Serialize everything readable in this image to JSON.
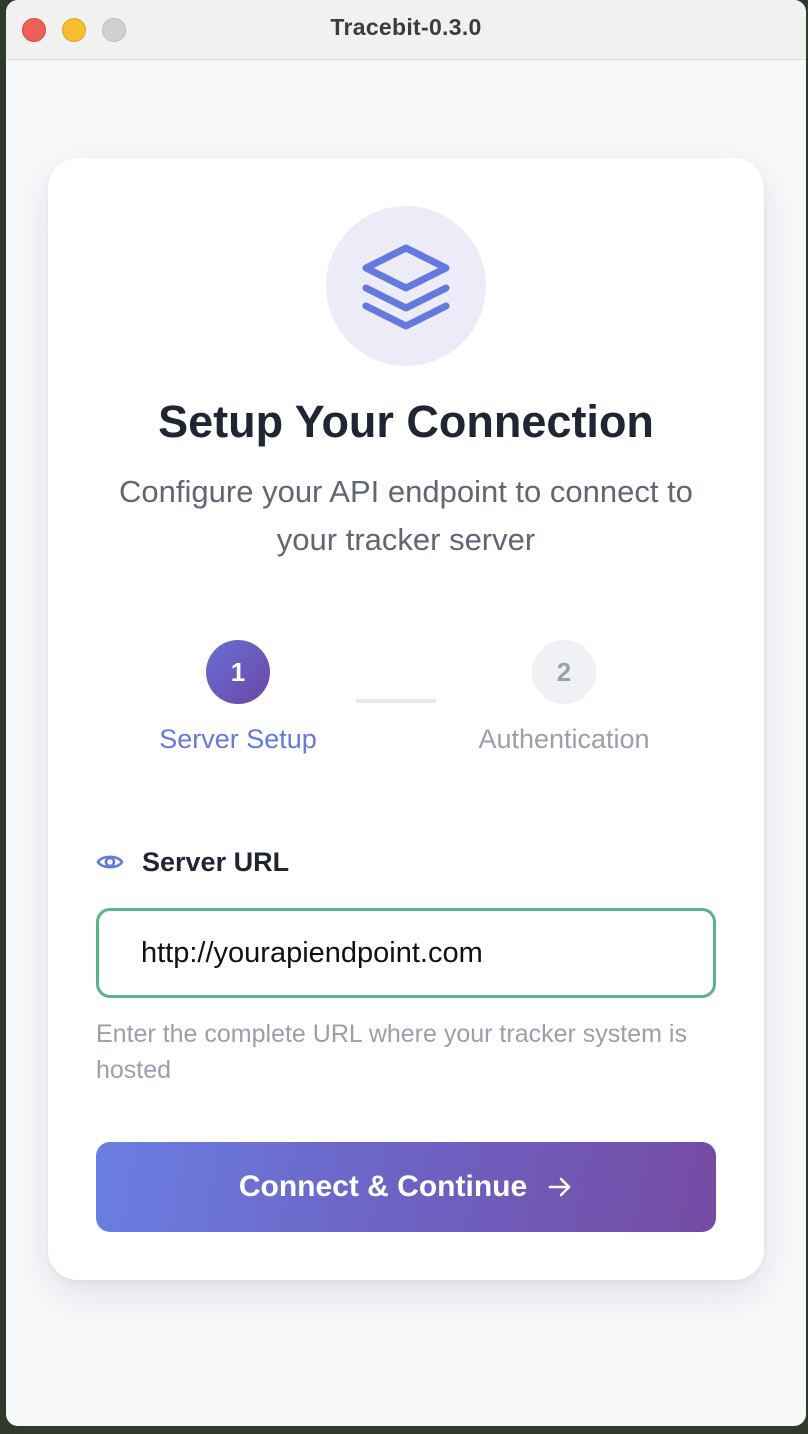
{
  "window": {
    "title": "Tracebit-0.3.0"
  },
  "header": {
    "logo_icon": "layers-icon",
    "title": "Setup Your Connection",
    "subtitle": "Configure your API endpoint to connect to your tracker server"
  },
  "steps": [
    {
      "number": "1",
      "label": "Server Setup",
      "state": "active"
    },
    {
      "number": "2",
      "label": "Authentication",
      "state": "inactive"
    }
  ],
  "form": {
    "label_icon": "eye-icon",
    "label": "Server URL",
    "value": "http://yourapiendpoint.com",
    "helper": "Enter the complete URL where your tracker system is hosted"
  },
  "button": {
    "label": "Connect & Continue",
    "icon": "arrow-right-icon"
  },
  "colors": {
    "accent": "#6479dd",
    "gradient_start": "#6a7fe2",
    "gradient_end": "#754ba3",
    "input_border": "#5bb487"
  }
}
